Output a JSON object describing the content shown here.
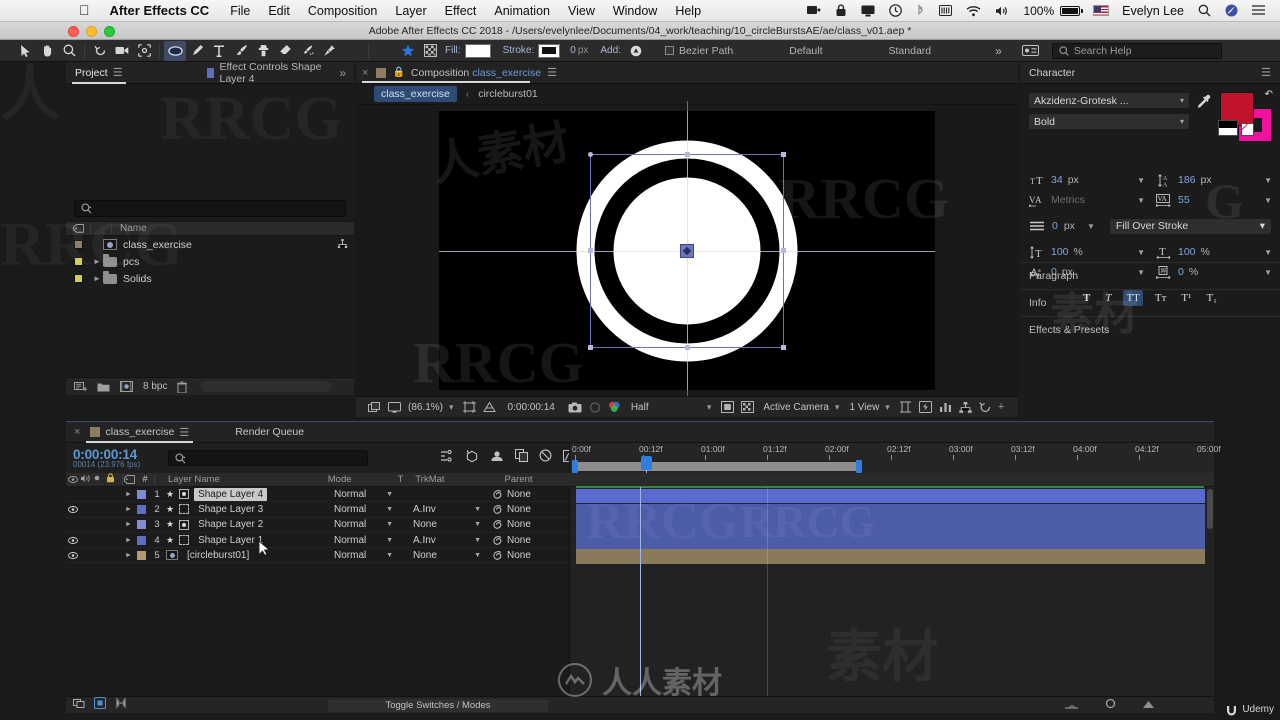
{
  "mac_menu": {
    "apple_icon": "apple-logo",
    "app_name": "After Effects CC",
    "items": [
      "File",
      "Edit",
      "Composition",
      "Layer",
      "Effect",
      "Animation",
      "View",
      "Window",
      "Help"
    ],
    "status": {
      "battery_percent": "100%",
      "user_name": "Evelyn Lee",
      "icons": [
        "screen-share-icon",
        "lock-icon",
        "display-icon",
        "time-machine-icon",
        "bluetooth-icon",
        "battery-icon",
        "wifi-icon",
        "volume-icon",
        "flag-icon",
        "search-icon",
        "siri-icon",
        "notification-center-icon"
      ]
    }
  },
  "title_bar": {
    "title": "Adobe After Effects CC 2018 - /Users/evelynlee/Documents/04_work/teaching/10_circleBurstsAE/ae/class_v01.aep *"
  },
  "toolbar": {
    "tools": [
      {
        "name": "selection-tool",
        "glyph": "arrow",
        "active": false
      },
      {
        "name": "hand-tool",
        "glyph": "hand",
        "active": false
      },
      {
        "name": "zoom-tool",
        "glyph": "magnifier",
        "active": false
      },
      {
        "name": "rotation-tool",
        "glyph": "rotate",
        "active": false
      },
      {
        "name": "camera-tool",
        "glyph": "camera",
        "active": false
      },
      {
        "name": "pan-behind-tool",
        "glyph": "anchor-pan",
        "active": false
      },
      {
        "name": "shape-tool",
        "glyph": "ellipse",
        "active": true
      },
      {
        "name": "pen-tool",
        "glyph": "pen",
        "active": false
      },
      {
        "name": "type-tool",
        "glyph": "type",
        "active": false
      },
      {
        "name": "brush-tool",
        "glyph": "brush",
        "active": false
      },
      {
        "name": "clone-stamp-tool",
        "glyph": "stamp",
        "active": false
      },
      {
        "name": "eraser-tool",
        "glyph": "eraser",
        "active": false
      },
      {
        "name": "roto-brush-tool",
        "glyph": "roto-brush",
        "active": false
      },
      {
        "name": "puppet-pin-tool",
        "glyph": "pin",
        "active": false
      }
    ],
    "snapping_star": "snapping-icon",
    "grid_icon": "transparency-grid-icon",
    "fill_label": "Fill:",
    "stroke_label": "Stroke:",
    "stroke_width": "0",
    "stroke_unit": "px",
    "add_label": "Add:",
    "bezier_path": "Bezier Path",
    "workspace_default": "Default",
    "workspace_standard": "Standard",
    "overflow": "»",
    "search_placeholder": "Search Help"
  },
  "project_panel": {
    "tab_label": "Project",
    "effect_controls_tab": "Effect Controls Shape Layer 4",
    "overflow": "»",
    "search_placeholder": "",
    "col_name": "Name",
    "items": [
      {
        "name": "class_exercise",
        "type": "composition",
        "chip": "#8c7d63",
        "expandable": false,
        "has_link_icon": true
      },
      {
        "name": "pcs",
        "type": "folder",
        "chip": "#d4cf4a",
        "expandable": true,
        "has_link_icon": false
      },
      {
        "name": "Solids",
        "type": "folder",
        "chip": "#d4cf4a",
        "expandable": true,
        "has_link_icon": false
      }
    ],
    "footer": {
      "bit_depth": "8 bpc",
      "icons": [
        "new-comp-icon",
        "new-folder-icon",
        "comp-settings-icon",
        "delete-icon"
      ]
    }
  },
  "comp_panel": {
    "tab_prefix": "Composition",
    "tab_name": "class_exercise",
    "lock_icon": "lock-icon",
    "close_icon": "close-icon",
    "menu_icon": "panel-menu-icon",
    "breadcrumb": {
      "root": "class_exercise",
      "separator": "‹",
      "current": "circleburst01"
    },
    "viewer_bar": {
      "zoom": "(86.1%)",
      "time": "0:00:00:14",
      "resolution": "Half",
      "camera": "Active Camera",
      "views": "1 View",
      "icons": [
        "always-preview-icon",
        "main-viewer-icon",
        "region-of-interest-icon",
        "grid-guides-icon",
        "snapshot-icon",
        "show-snapshot-icon",
        "channel-icon",
        "toggle-mask-icon",
        "toggle-transparency-icon",
        "timeline-icon",
        "comp-flowchart-icon",
        "reset-exposure-icon"
      ]
    }
  },
  "character_panel": {
    "title": "Character",
    "menu_icon": "panel-menu-icon",
    "font_family": "Akzidenz-Grotesk ...",
    "font_style": "Bold",
    "eyedropper": "eyedropper-icon",
    "fill_color": "#c1122e",
    "stroke_color": "#f0119f",
    "font_size": "34",
    "font_size_unit": "px",
    "leading": "186",
    "leading_unit": "px",
    "kerning": "Metrics",
    "tracking": "55",
    "stroke_width": "0",
    "stroke_width_unit": "px",
    "fill_over_stroke": "Fill Over Stroke",
    "vertical_scale": "100",
    "vertical_scale_unit": "%",
    "horizontal_scale": "100",
    "horizontal_scale_unit": "%",
    "baseline_shift": "0",
    "baseline_shift_unit": "px",
    "tsume": "0",
    "tsume_unit": "%",
    "style_buttons": [
      {
        "label": "T",
        "name": "faux-bold-button",
        "active": false
      },
      {
        "label": "T",
        "name": "faux-italic-button",
        "active": false
      },
      {
        "label": "TT",
        "name": "all-caps-button",
        "active": true
      },
      {
        "label": "Tᴛ",
        "name": "small-caps-button",
        "active": false
      },
      {
        "label": "T¹",
        "name": "superscript-button",
        "active": false
      },
      {
        "label": "T₁",
        "name": "subscript-button",
        "active": false
      }
    ],
    "accordions": [
      "Paragraph",
      "Info",
      "Effects & Presets"
    ]
  },
  "timeline": {
    "tabs": [
      {
        "label": "class_exercise",
        "active": true
      },
      {
        "label": "Render Queue",
        "active": false
      }
    ],
    "current_time": "0:00:00:14",
    "frame_info": "00014 (23.976 fps)",
    "search_placeholder": "",
    "control_icons": [
      "live-update-icon",
      "draft-3d-icon",
      "hide-shy-icon",
      "frame-blending-icon",
      "motion-blur-icon",
      "graph-editor-icon"
    ],
    "columns": [
      "Layer Name",
      "Mode",
      "T",
      "TrkMat",
      "Parent"
    ],
    "switch_icons": [
      "eye-icon",
      "audio-icon",
      "solo-icon",
      "lock-icon"
    ],
    "layers": [
      {
        "num": "1",
        "name": "Shape Layer 4",
        "mode": "Normal",
        "trkmat": "",
        "parent": "None",
        "visible": false,
        "selected": true,
        "chip": "#7d8cd4",
        "shape": "solid",
        "bar_color": "#5a6bd0",
        "bar_type": "shape"
      },
      {
        "num": "2",
        "name": "Shape Layer 3",
        "mode": "Normal",
        "trkmat": "A.Inv",
        "parent": "None",
        "visible": true,
        "selected": false,
        "chip": "#5d6fc4",
        "shape": "dash",
        "bar_color": "#4a5aa8",
        "bar_type": "shape"
      },
      {
        "num": "3",
        "name": "Shape Layer 2",
        "mode": "Normal",
        "trkmat": "None",
        "parent": "None",
        "visible": false,
        "selected": false,
        "chip": "#7d8cd4",
        "shape": "solid",
        "bar_color": "#4a5aa8",
        "bar_type": "shape"
      },
      {
        "num": "4",
        "name": "Shape Layer 1",
        "mode": "Normal",
        "trkmat": "A.Inv",
        "parent": "None",
        "visible": true,
        "selected": false,
        "chip": "#5d6fc4",
        "shape": "dash",
        "bar_color": "#4a5aa8",
        "bar_type": "shape"
      },
      {
        "num": "5",
        "name": "[circleburst01]",
        "mode": "Normal",
        "trkmat": "None",
        "parent": "None",
        "visible": true,
        "selected": false,
        "chip": "#b39a74",
        "shape": "comp",
        "bar_color": "#8a7css",
        "bar_type": "comp"
      }
    ],
    "ruler_labels": [
      "0:00f",
      "00:12f",
      "01:00f",
      "01:12f",
      "02:00f",
      "02:12f",
      "03:00f",
      "03:12f",
      "04:00f",
      "04:12f",
      "05:00f"
    ],
    "work_area_end_label": "02:12f",
    "footer": {
      "toggle_label": "Toggle Switches / Modes",
      "icons": [
        "comp-flowchart-icon",
        "draft-3d-icon",
        "motion-blur-icon"
      ]
    }
  },
  "branding": {
    "udemy": "Udemy",
    "watermark_center": "人人素材",
    "watermark_rrcg": "RRCG"
  },
  "colors": {
    "accent_blue": "#5b9bd5",
    "selection_blue": "#2f4a73",
    "panel_bg": "#1b1b1b",
    "toolbar_bg": "#2b2b2b",
    "comp_chip": "#8c7d63"
  }
}
